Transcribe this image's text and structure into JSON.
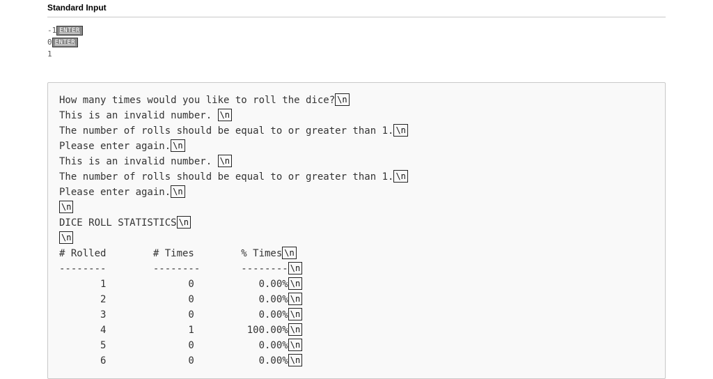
{
  "section_title": "Standard Input",
  "enter_label": "ENTER",
  "newline_label": "\\n",
  "input_lines": [
    {
      "text": "-1",
      "enter": true
    },
    {
      "text": "0",
      "enter": true
    },
    {
      "text": "1",
      "enter": false
    }
  ],
  "output_lines": [
    {
      "text": "How many times would you like to roll the dice?",
      "nl": true
    },
    {
      "text": "This is an invalid number. ",
      "nl": true
    },
    {
      "text": "The number of rolls should be equal to or greater than 1.",
      "nl": true
    },
    {
      "text": "Please enter again.",
      "nl": true
    },
    {
      "text": "This is an invalid number. ",
      "nl": true
    },
    {
      "text": "The number of rolls should be equal to or greater than 1.",
      "nl": true
    },
    {
      "text": "Please enter again.",
      "nl": true
    },
    {
      "text": "",
      "nl": true
    },
    {
      "text": "DICE ROLL STATISTICS",
      "nl": true
    },
    {
      "text": "",
      "nl": true
    },
    {
      "text": "# Rolled        # Times        % Times",
      "nl": true
    },
    {
      "text": "--------        --------       --------",
      "nl": true
    },
    {
      "text": "       1              0           0.00%",
      "nl": true
    },
    {
      "text": "       2              0           0.00%",
      "nl": true
    },
    {
      "text": "       3              0           0.00%",
      "nl": true
    },
    {
      "text": "       4              1         100.00%",
      "nl": true
    },
    {
      "text": "       5              0           0.00%",
      "nl": true
    },
    {
      "text": "       6              0           0.00%",
      "nl": true
    }
  ]
}
